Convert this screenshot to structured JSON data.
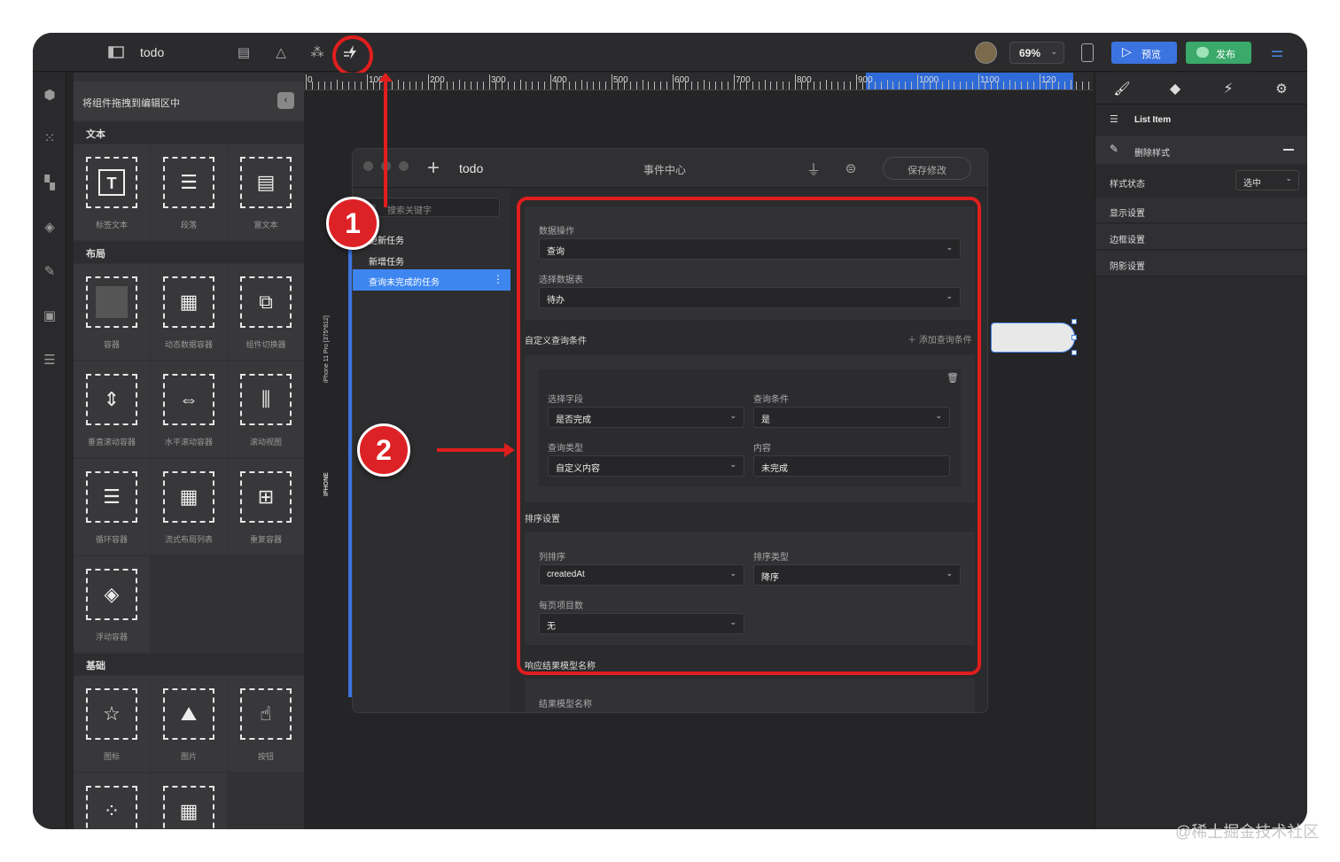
{
  "topbar": {
    "project_name": "todo",
    "zoom": "69%",
    "preview_label": "预览",
    "publish_label": "发布"
  },
  "components": {
    "header": "将组件拖拽到编辑区中",
    "sections": [
      {
        "title": "文本",
        "items": [
          "标签文本",
          "段落",
          "富文本"
        ]
      },
      {
        "title": "布局",
        "items": [
          "容器",
          "动态数据容器",
          "组件切换器",
          "垂直滚动容器",
          "水平滚动容器",
          "滚动视图",
          "循环容器",
          "流式布局列表",
          "重复容器",
          "浮动容器"
        ]
      },
      {
        "title": "基础",
        "items": [
          "图标",
          "图片",
          "按钮"
        ]
      }
    ]
  },
  "ruler": {
    "ticks": [
      "0",
      "100",
      "200",
      "300",
      "400",
      "500",
      "600",
      "700",
      "800",
      "900",
      "1000",
      "1100",
      "120"
    ]
  },
  "device": {
    "model_label": "iPhone 11 Pro [375*812]",
    "type_label": "IPHONE"
  },
  "event_center": {
    "add_label": "+",
    "app_name": "todo",
    "title": "事件中心",
    "save_label": "保存修改",
    "search_placeholder": "搜索关键字",
    "events": [
      "更新任务",
      "新增任务",
      "查询未完成的任务"
    ],
    "data_op_label": "数据操作",
    "data_op_value": "查询",
    "table_label": "选择数据表",
    "table_value": "待办",
    "custom_cond_title": "自定义查询条件",
    "add_cond_label": "添加查询条件",
    "field_label": "选择字段",
    "field_value": "是否完成",
    "cond_label": "查询条件",
    "cond_value": "是",
    "qtype_label": "查询类型",
    "qtype_value": "自定义内容",
    "content_label": "内容",
    "content_value": "未完成",
    "sort_title": "排序设置",
    "col_sort_label": "列排序",
    "col_sort_value": "createdAt",
    "sort_type_label": "排序类型",
    "sort_type_value": "降序",
    "page_items_label": "每页项目数",
    "page_items_value": "无",
    "result_title": "响应结果模型名称",
    "result_field_label": "结果模型名称"
  },
  "right_panel": {
    "component_name": "List Item",
    "delete_style_label": "删除样式",
    "style_state_label": "样式状态",
    "style_state_value": "选中",
    "rows": [
      "显示设置",
      "边框设置",
      "阴影设置"
    ]
  },
  "annotations": {
    "badge1": "1",
    "badge2": "2"
  },
  "watermark": "@稀土掘金技术社区"
}
